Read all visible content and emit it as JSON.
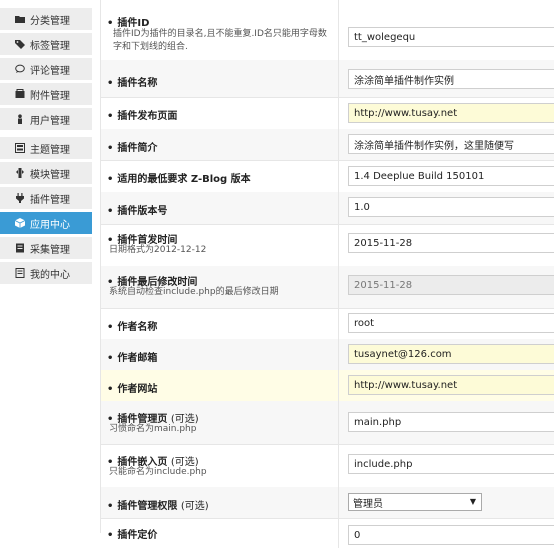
{
  "sidebar": {
    "items": [
      {
        "label": "分类管理",
        "icon": "folder-icon"
      },
      {
        "label": "标签管理",
        "icon": "tag-icon"
      },
      {
        "label": "评论管理",
        "icon": "comment-icon"
      },
      {
        "label": "附件管理",
        "icon": "attachment-icon"
      },
      {
        "label": "用户管理",
        "icon": "user-icon"
      },
      {
        "label": "主题管理",
        "icon": "theme-icon"
      },
      {
        "label": "模块管理",
        "icon": "module-icon"
      },
      {
        "label": "插件管理",
        "icon": "plugin-icon"
      },
      {
        "label": "应用中心",
        "icon": "app-center-icon",
        "active": true
      },
      {
        "label": "采集管理",
        "icon": "collect-icon"
      },
      {
        "label": "我的中心",
        "icon": "my-center-icon"
      }
    ]
  },
  "form": {
    "bullet": "•",
    "plugin_id": {
      "label": "插件ID",
      "desc": "插件ID为插件的目录名,且不能重复.ID名只能用字母数字和下划线的组合.",
      "value": "tt_wolegequ"
    },
    "plugin_name": {
      "label": "插件名称",
      "value": "涂涂简单插件制作实例"
    },
    "publish_page": {
      "label": "插件发布页面",
      "value": "http://www.tusay.net"
    },
    "intro": {
      "label": "插件简介",
      "value": "涂涂简单插件制作实例，这里随便写"
    },
    "min_version": {
      "label": "适用的最低要求 Z-Blog 版本",
      "value": "1.4 Deeplue Build 150101"
    },
    "version": {
      "label": "插件版本号",
      "value": "1.0"
    },
    "first_release": {
      "label": "插件首发时间",
      "desc": "日期格式为2012-12-12",
      "value": "2015-11-28"
    },
    "last_modified": {
      "label": "插件最后修改时间",
      "desc": "系统自动检查include.php的最后修改日期",
      "value": "2015-11-28"
    },
    "author_name": {
      "label": "作者名称",
      "value": "root"
    },
    "author_email": {
      "label": "作者邮箱",
      "value": "tusaynet@126.com"
    },
    "author_site": {
      "label": "作者网站",
      "value": "http://www.tusay.net"
    },
    "manage_page": {
      "label": "插件管理页",
      "optional": "(可选)",
      "desc": "习惯命名为main.php",
      "value": "main.php"
    },
    "embed_page": {
      "label": "插件嵌入页",
      "optional": "(可选)",
      "desc": "只能命名为include.php",
      "value": "include.php"
    },
    "permission": {
      "label": "插件管理权限",
      "optional": "(可选)",
      "value": "管理员"
    },
    "priority": {
      "label": "插件定价",
      "value": "0"
    }
  }
}
